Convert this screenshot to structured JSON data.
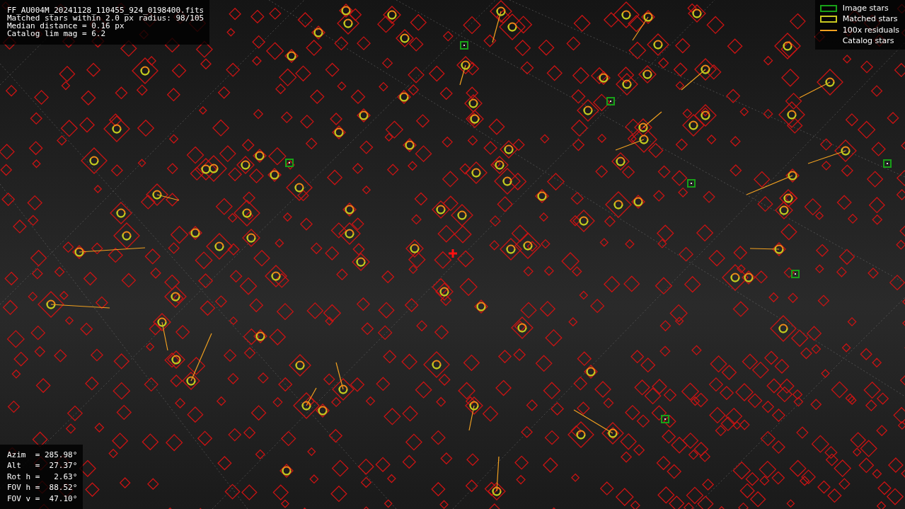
{
  "info_box": {
    "lines": [
      "FF_AU004M_20241128_110455_924_0198400.fits",
      "Matched stars within 2.0 px radius: 98/105",
      "Median distance = 0.16 px",
      "Catalog lim mag = 6.2"
    ]
  },
  "legend": [
    {
      "kind": "image",
      "label": "Image stars"
    },
    {
      "kind": "matched",
      "label": "Matched stars"
    },
    {
      "kind": "residual",
      "label": "100x residuals"
    },
    {
      "kind": "catalog",
      "label": "Catalog stars"
    }
  ],
  "pointing_box": {
    "lines": [
      "Azim  = 285.98°",
      "Alt   =  27.37°",
      "Rot h =   2.63°",
      "FOV h =  88.52°",
      "FOV v =  47.10°"
    ]
  }
}
